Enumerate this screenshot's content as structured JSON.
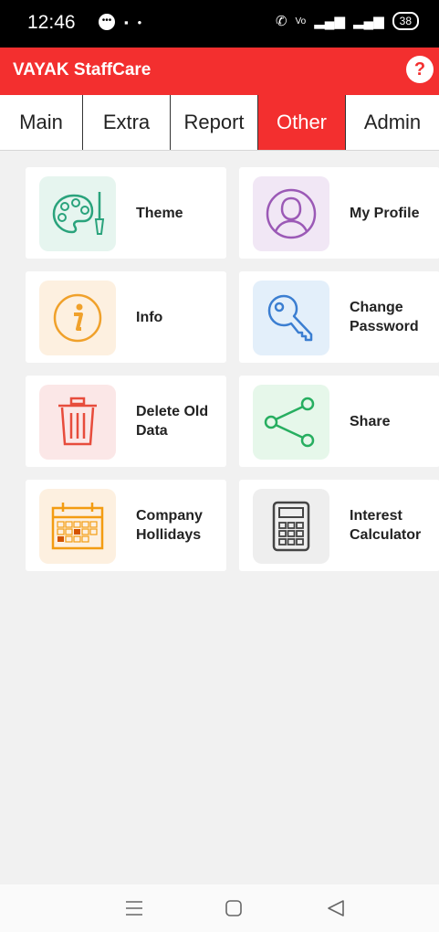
{
  "status": {
    "time": "12:46",
    "battery": "38"
  },
  "app": {
    "title": "VAYAK StaffCare",
    "help": "?"
  },
  "tabs": [
    {
      "label": "Main",
      "active": false
    },
    {
      "label": "Extra",
      "active": false
    },
    {
      "label": "Report",
      "active": false
    },
    {
      "label": "Other",
      "active": true
    },
    {
      "label": "Admin",
      "active": false
    }
  ],
  "cards": [
    {
      "label": "Theme",
      "icon": "palette-icon",
      "bg": "#e6f5ef",
      "color": "#2aa37c"
    },
    {
      "label": "My Profile",
      "icon": "profile-icon",
      "bg": "#f1e7f5",
      "color": "#9b59b6"
    },
    {
      "label": "Info",
      "icon": "info-icon",
      "bg": "#fdf0e0",
      "color": "#f0a12b"
    },
    {
      "label": "Change Password",
      "icon": "key-icon",
      "bg": "#e3effa",
      "color": "#3b7ed1"
    },
    {
      "label": "Delete Old Data",
      "icon": "trash-icon",
      "bg": "#fbe7e7",
      "color": "#e74c3c"
    },
    {
      "label": "Share",
      "icon": "share-icon",
      "bg": "#e6f7ea",
      "color": "#27ae60"
    },
    {
      "label": "Company Hollidays",
      "icon": "calendar-icon",
      "bg": "#fdf0e0",
      "color": "#f39c12"
    },
    {
      "label": "Interest Calculator",
      "icon": "calculator-icon",
      "bg": "#eeeeee",
      "color": "#444444"
    }
  ]
}
